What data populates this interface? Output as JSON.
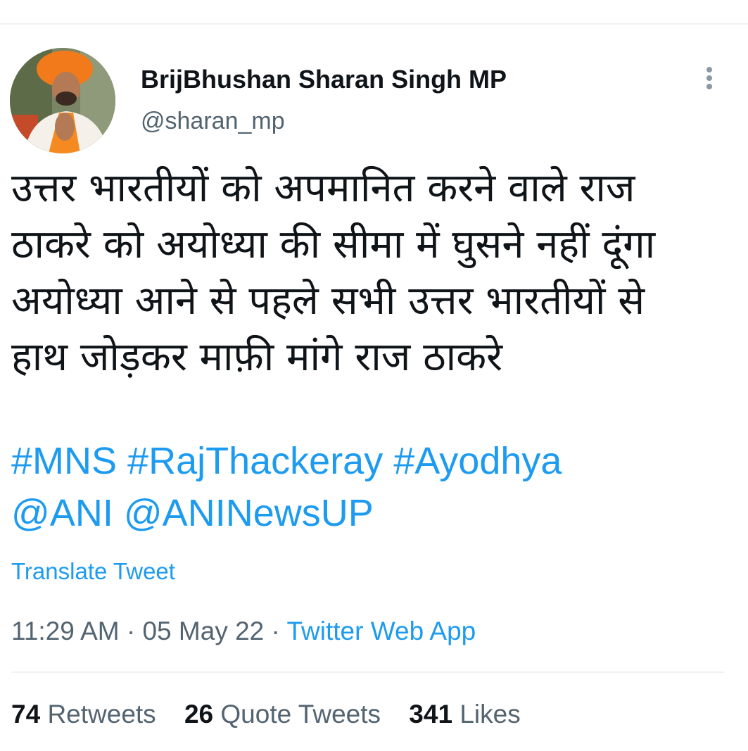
{
  "author": {
    "name": "BrijBhushan Sharan Singh MP",
    "handle": "@sharan_mp"
  },
  "tweet": {
    "lines": [
      "उत्तर भारतीयों को अपमानित करने वाले राज",
      "ठाकरे को अयोध्या की सीमा में घुसने नहीं दूंगा",
      "अयोध्या आने से पहले सभी उत्तर भारतीयों से",
      "हाथ जोड़कर माफ़ी मांगे राज ठाकरे"
    ],
    "hashtags": [
      "#MNS",
      "#RajThackeray",
      "#Ayodhya"
    ],
    "mentions": [
      "@ANI",
      "@ANINewsUP"
    ],
    "translate_label": "Translate Tweet",
    "time": "11:29 AM",
    "separator": "·",
    "date": "05 May 22",
    "source": "Twitter Web App"
  },
  "stats": {
    "retweets_count": "74",
    "retweets_label": "Retweets",
    "quotes_count": "26",
    "quotes_label": "Quote Tweets",
    "likes_count": "341",
    "likes_label": "Likes"
  },
  "icons": {
    "more": "more-vertical-icon"
  },
  "colors": {
    "link": "#1d9bf0",
    "secondary_text": "#536471",
    "primary_text": "#0f1419"
  }
}
